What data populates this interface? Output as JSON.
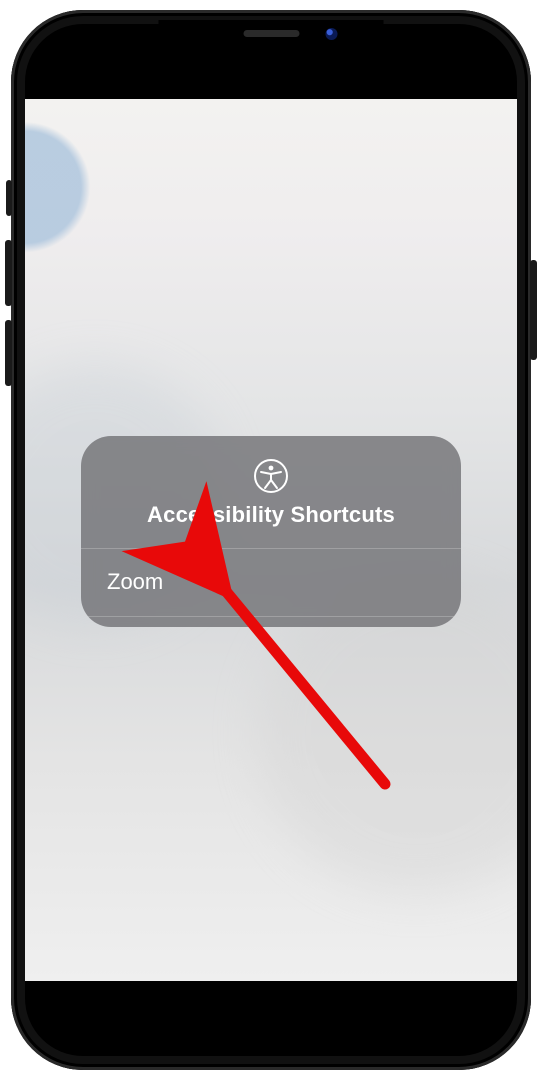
{
  "modal": {
    "title": "Accessibility Shortcuts",
    "icon": "accessibility-icon",
    "items": [
      {
        "label": "Zoom"
      }
    ]
  },
  "annotation": {
    "type": "arrow",
    "color": "#e80909"
  }
}
